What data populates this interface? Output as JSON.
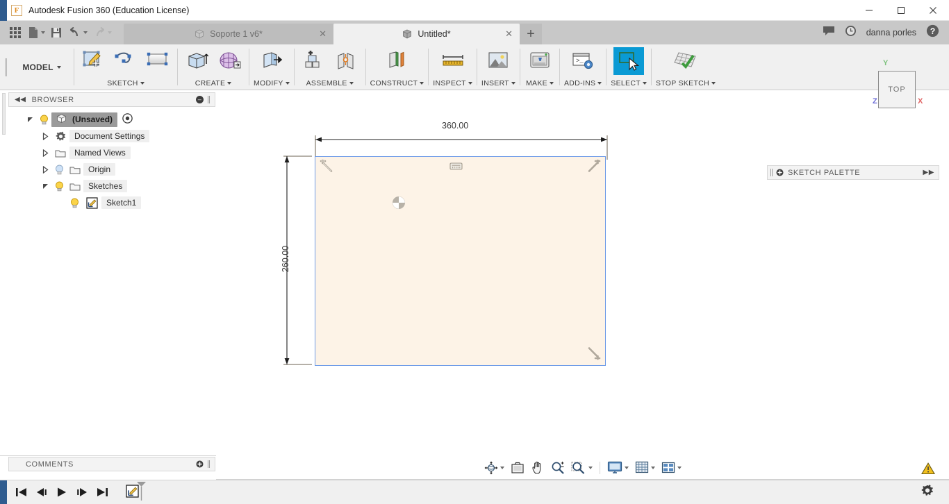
{
  "window": {
    "app_title": "Autodesk Fusion 360 (Education License)",
    "app_icon": "fusion-logo-icon",
    "minimize_label": "—",
    "maximize_label": "□",
    "close_label": "✕"
  },
  "quick_access": {
    "show_data_panel": "grid-icon",
    "new_file": "file-icon",
    "save": "save-icon",
    "undo": "undo-icon",
    "redo": "redo-icon"
  },
  "tabs": {
    "items": [
      {
        "label": "Soporte 1 v6*",
        "active": false,
        "close": "✕"
      },
      {
        "label": "Untitled*",
        "active": true,
        "close": "✕"
      }
    ],
    "new_tab": "+",
    "comments_icon": "comments-icon",
    "recent_icon": "clock-icon",
    "user": "danna porles",
    "help_icon": "help-icon"
  },
  "ribbon": {
    "workspace": "MODEL",
    "panels": [
      {
        "label": "SKETCH",
        "tools": [
          "create-sketch-icon",
          "spline-icon",
          "rectangle-icon"
        ]
      },
      {
        "label": "CREATE",
        "tools": [
          "extrude-icon",
          "revolve-icon"
        ]
      },
      {
        "label": "MODIFY",
        "tools": [
          "press-pull-icon"
        ]
      },
      {
        "label": "ASSEMBLE",
        "tools": [
          "new-component-icon",
          "joint-icon"
        ]
      },
      {
        "label": "CONSTRUCT",
        "tools": [
          "offset-plane-icon"
        ]
      },
      {
        "label": "INSPECT",
        "tools": [
          "measure-icon"
        ]
      },
      {
        "label": "INSERT",
        "tools": [
          "insert-mcmaster-icon"
        ]
      },
      {
        "label": "MAKE",
        "tools": [
          "3d-print-icon"
        ]
      },
      {
        "label": "ADD-INS",
        "tools": [
          "scripts-addins-icon"
        ]
      },
      {
        "label": "SELECT",
        "tools": [
          "select-icon"
        ],
        "active": true
      },
      {
        "label": "STOP SKETCH",
        "tools": [
          "stop-sketch-icon"
        ]
      }
    ]
  },
  "browser": {
    "header": "BROWSER",
    "collapse_icon": "collapse-left-icon",
    "minimize_icon": "–",
    "tree": [
      {
        "label": "(Unsaved)",
        "indent": 0,
        "expander": "open",
        "bulb": true,
        "icon": "component-icon",
        "selected": true,
        "trailing": "target-icon"
      },
      {
        "label": "Document Settings",
        "indent": 1,
        "expander": "closed",
        "bulb": false,
        "icon": "gear-icon"
      },
      {
        "label": "Named Views",
        "indent": 1,
        "expander": "closed",
        "bulb": false,
        "icon": "folder-icon"
      },
      {
        "label": "Origin",
        "indent": 1,
        "expander": "closed",
        "bulb": true,
        "icon": "folder-icon"
      },
      {
        "label": "Sketches",
        "indent": 1,
        "expander": "open",
        "bulb": true,
        "icon": "folder-icon"
      },
      {
        "label": "Sketch1",
        "indent": 2,
        "expander": "none",
        "bulb": true,
        "icon": "sketch-icon"
      }
    ]
  },
  "canvas": {
    "horizontal_dimension": "360.00",
    "vertical_dimension": "260.00",
    "rect_fill_color": "#fdf3e7",
    "rect_stroke_color": "#6f9ce8",
    "constraints": [
      "perpendicular-constraint-icon",
      "horizontal-constraint-icon",
      "perpendicular-constraint-icon",
      "perpendicular-constraint-icon",
      "origin-point-icon"
    ],
    "viewcube": {
      "face_label": "TOP",
      "axis_y": "Y",
      "axis_x": "X",
      "axis_z": "Z",
      "color_y": "#7ec27e",
      "color_x": "#e06565",
      "color_z": "#6b6bd6"
    }
  },
  "sketch_palette": {
    "header": "SKETCH PALETTE",
    "pin_icon": "pin-icon",
    "expand_icon": "expand-right-icon"
  },
  "comments": {
    "header": "COMMENTS",
    "add_icon": "add-comment-icon"
  },
  "nav_bar": {
    "buttons": [
      {
        "name": "orbit-icon",
        "caret": true
      },
      {
        "name": "look-at-icon",
        "caret": false
      },
      {
        "name": "pan-icon",
        "caret": false
      },
      {
        "name": "zoom-icon",
        "caret": false
      },
      {
        "name": "zoom-window-icon",
        "caret": true
      },
      {
        "name": "display-settings-icon",
        "caret": true
      },
      {
        "name": "grid-snaps-icon",
        "caret": true
      },
      {
        "name": "viewports-icon",
        "caret": true
      }
    ],
    "warning_icon": "warning-icon"
  },
  "timeline": {
    "buttons": [
      "go-to-beginning-icon",
      "step-back-icon",
      "play-icon",
      "step-forward-icon",
      "go-to-end-icon"
    ],
    "marker": "sketch1-timeline-icon",
    "settings_icon": "timeline-settings-icon"
  }
}
